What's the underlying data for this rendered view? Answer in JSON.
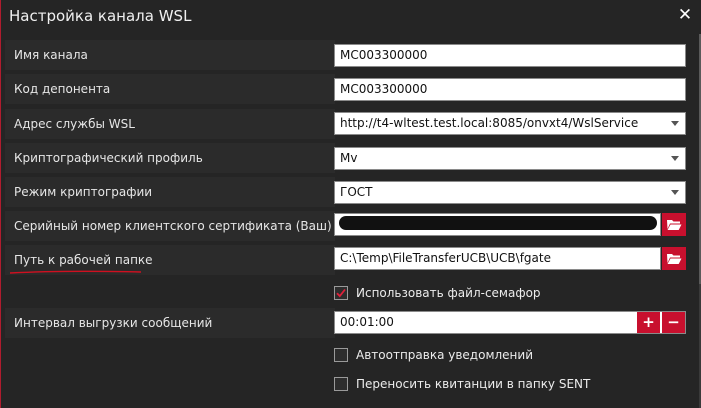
{
  "dialog": {
    "title": "Настройка канала WSL"
  },
  "fields": {
    "channel_name": {
      "label": "Имя канала",
      "value": "MC003300000"
    },
    "depositor_code": {
      "label": "Код депонента",
      "value": "MC003300000"
    },
    "wsl_service_address": {
      "label": "Адрес службы WSL",
      "value": "http://t4-wltest.test.local:8085/onvxt4/WslService"
    },
    "crypto_profile": {
      "label": "Криптографический профиль",
      "value": "Mv"
    },
    "crypto_mode": {
      "label": "Режим криптографии",
      "value": "ГОСТ"
    },
    "client_cert_serial": {
      "label": "Серийный номер клиентского сертификата (Ваш)",
      "value": ""
    },
    "work_folder_path": {
      "label": "Путь к рабочей папке",
      "value": "C:\\Temp\\FileTransferUCB\\UCB\\fgate"
    },
    "upload_interval": {
      "label": "Интервал выгрузки сообщений",
      "value": "00:01:00",
      "plus": "+",
      "minus": "−"
    }
  },
  "checkboxes": {
    "use_semaphore": {
      "label": "Использовать файл-семафор",
      "checked": true
    },
    "auto_notify": {
      "label": "Автоотправка уведомлений",
      "checked": false
    },
    "move_receipts": {
      "label": "Переносить квитанции в папку SENT",
      "checked": false
    }
  },
  "colors": {
    "accent": "#c8102e",
    "background": "#252525",
    "annotation": "#d01020"
  }
}
